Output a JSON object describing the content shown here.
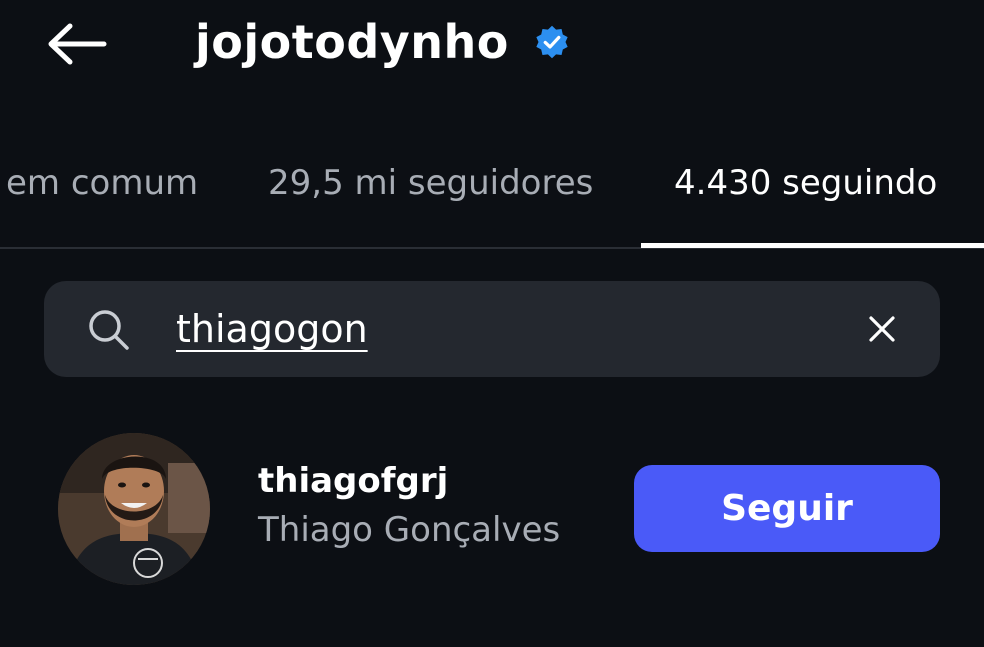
{
  "header": {
    "title": "jojotodynho",
    "verified": true,
    "back_icon": "arrow-left-icon"
  },
  "tabs": [
    {
      "label": "em comum",
      "active": false
    },
    {
      "label": "29,5 mi seguidores",
      "active": false
    },
    {
      "label": "4.430 seguindo",
      "active": true
    }
  ],
  "search": {
    "value": "thiagogon",
    "icon": "search-icon",
    "clear_icon": "close-icon"
  },
  "results": [
    {
      "username": "thiagofgrj",
      "full_name": "Thiago Gonçalves",
      "button_label": "Seguir"
    }
  ],
  "colors": {
    "background": "#0c0f14",
    "search_bg": "#24282f",
    "accent": "#4a5af8",
    "verified": "#2c8ff0",
    "muted_text": "#a8adb5"
  }
}
